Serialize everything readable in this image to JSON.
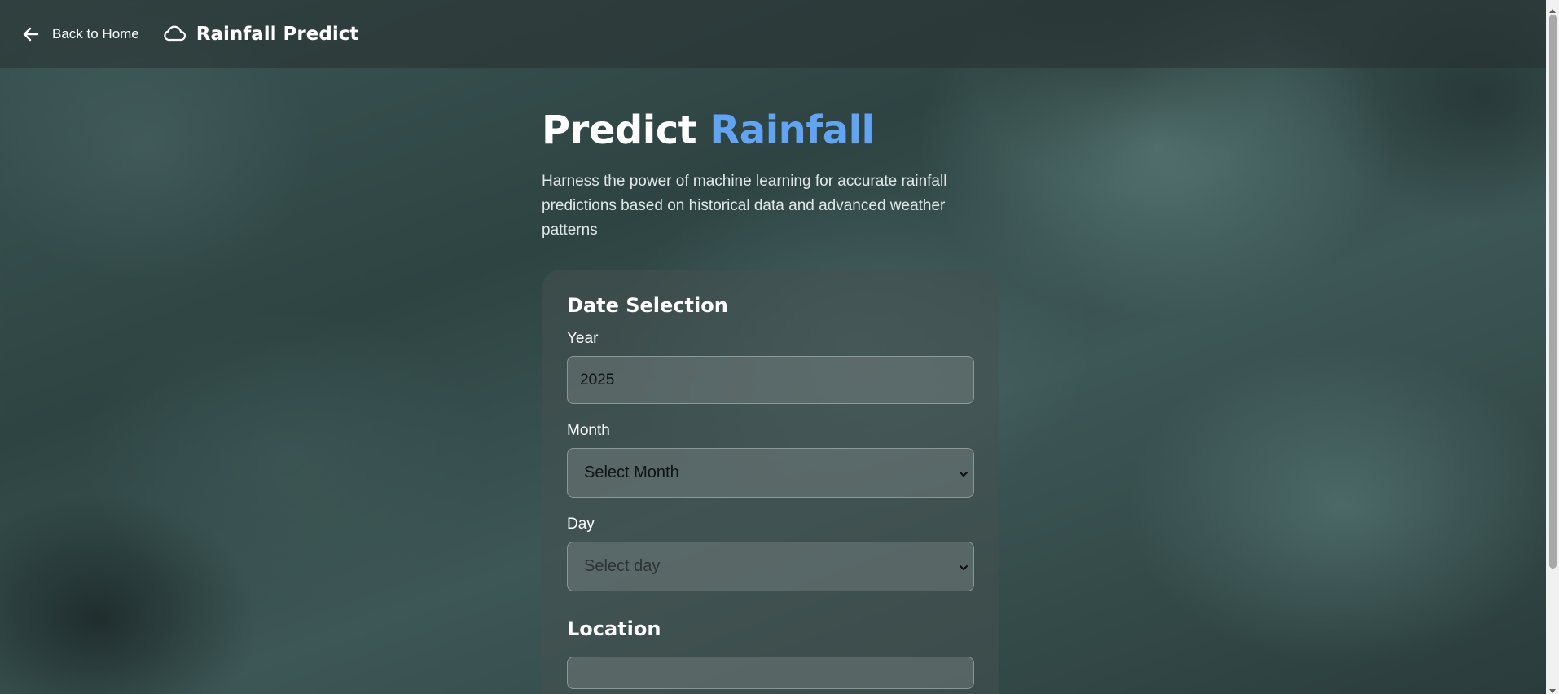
{
  "header": {
    "back_label": "Back to Home",
    "brand_title": "Rainfall Predict"
  },
  "hero": {
    "title_main": "Predict",
    "title_accent": "Rainfall",
    "subtitle": "Harness the power of machine learning for accurate rainfall predictions based on historical data and advanced weather patterns"
  },
  "form": {
    "date_section_title": "Date Selection",
    "year_label": "Year",
    "year_value": "2025",
    "month_label": "Month",
    "month_selected": "Select Month",
    "day_label": "Day",
    "day_selected": "Select day",
    "location_section_title": "Location"
  },
  "colors": {
    "accent": "#63a4f2",
    "header_bg": "#283030"
  },
  "icons": [
    "arrow-left-icon",
    "cloud-icon",
    "chevron-down-icon"
  ]
}
